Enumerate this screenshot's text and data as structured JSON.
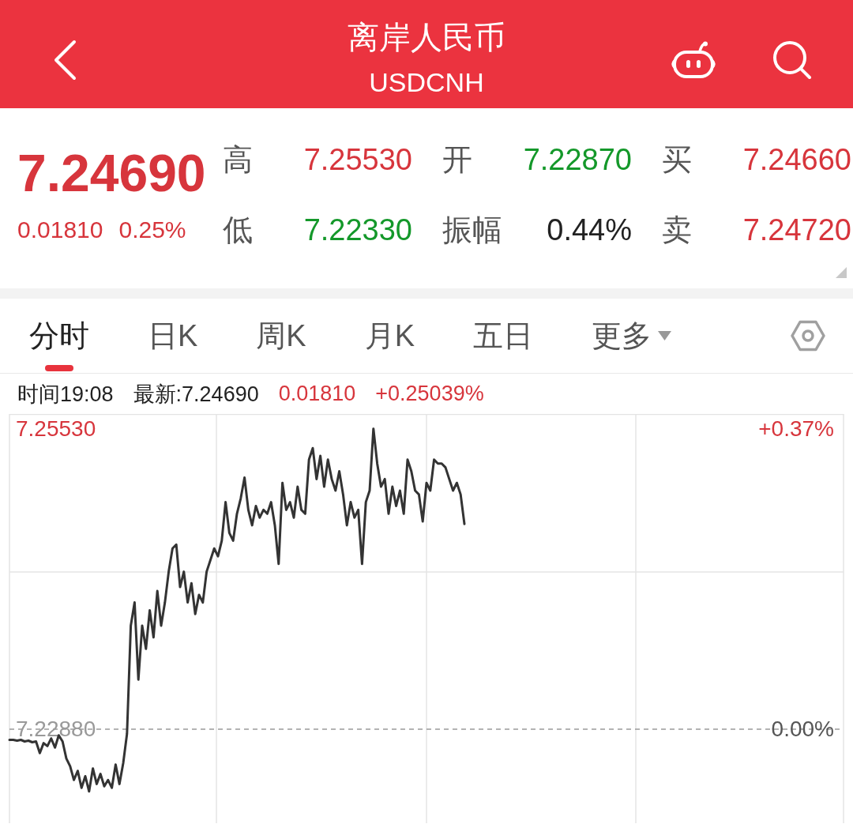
{
  "header": {
    "title": "离岸人民币",
    "subtitle": "USDCNH"
  },
  "quote": {
    "price": "7.24690",
    "change": "0.01810",
    "change_percent": "0.25%",
    "color": "#d7353c",
    "fields": [
      {
        "label": "高",
        "value": "7.25530",
        "color": "#d7353c"
      },
      {
        "label": "开",
        "value": "7.22870",
        "color": "#14982a"
      },
      {
        "label": "买",
        "value": "7.24660",
        "color": "#d7353c"
      },
      {
        "label": "低",
        "value": "7.22330",
        "color": "#14982a"
      },
      {
        "label": "振幅",
        "value": "0.44%",
        "color": "#222222"
      },
      {
        "label": "卖",
        "value": "7.24720",
        "color": "#d7353c"
      }
    ]
  },
  "tabs": [
    {
      "label": "分时",
      "selected": true,
      "kind": "tab"
    },
    {
      "label": "日K",
      "selected": false,
      "kind": "tab"
    },
    {
      "label": "周K",
      "selected": false,
      "kind": "tab"
    },
    {
      "label": "月K",
      "selected": false,
      "kind": "tab"
    },
    {
      "label": "五日",
      "selected": false,
      "kind": "tab"
    },
    {
      "label": "更多",
      "selected": false,
      "kind": "menu"
    }
  ],
  "info_bar": [
    {
      "text": "时间19:08",
      "color": "#222222"
    },
    {
      "text": "最新:7.24690",
      "color": "#222222"
    },
    {
      "text": "0.01810",
      "color": "#d7353c"
    },
    {
      "text": "+0.25039%",
      "color": "#d7353c"
    }
  ],
  "chart": {
    "chart_data": {
      "type": "line",
      "ylim": [
        7.2205,
        7.2566
      ],
      "yticks": [
        {
          "value": 7.2553,
          "label": "7.25530"
        },
        {
          "value": 7.2288,
          "label": "7.22880"
        }
      ],
      "ref_lines": [
        {
          "axis": "y",
          "value": 7.2288
        }
      ],
      "annotations": [
        "+0.37%",
        "0.00%"
      ],
      "series": [
        {
          "color": "#333333",
          "values": [
            7.22785,
            7.22785,
            7.22778,
            7.22785,
            7.22771,
            7.22778,
            7.22764,
            7.22771,
            7.22669,
            7.22757,
            7.2273,
            7.22798,
            7.22717,
            7.22826,
            7.22771,
            7.22621,
            7.22553,
            7.22431,
            7.22512,
            7.22362,
            7.22465,
            7.2233,
            7.22533,
            7.22396,
            7.22485,
            7.22376,
            7.22431,
            7.22362,
            7.22567,
            7.22396,
            7.2258,
            7.22839,
            7.23793,
            7.23997,
            7.23316,
            7.23793,
            7.23588,
            7.23929,
            7.2369,
            7.24099,
            7.23793,
            7.23997,
            7.24269,
            7.24474,
            7.24508,
            7.24133,
            7.24269,
            7.23997,
            7.24167,
            7.23895,
            7.24065,
            7.23997,
            7.24269,
            7.24371,
            7.24474,
            7.24405,
            7.24542,
            7.24882,
            7.2461,
            7.24542,
            7.2478,
            7.24916,
            7.251,
            7.24814,
            7.24678,
            7.24848,
            7.24746,
            7.24814,
            7.2478,
            7.24882,
            7.24678,
            7.24337,
            7.25052,
            7.24814,
            7.24882,
            7.24746,
            7.25018,
            7.24814,
            7.2478,
            7.25257,
            7.25359,
            7.25086,
            7.25291,
            7.25018,
            7.25257,
            7.25086,
            7.24984,
            7.25155,
            7.2495,
            7.24678,
            7.24882,
            7.24746,
            7.24814,
            7.24337,
            7.24882,
            7.24984,
            7.2553,
            7.25223,
            7.25018,
            7.25086,
            7.2478,
            7.25018,
            7.24848,
            7.24984,
            7.2478,
            7.25257,
            7.25155,
            7.24984,
            7.2495,
            7.24712,
            7.25052,
            7.24984,
            7.25257,
            7.25223,
            7.25223,
            7.25189,
            7.25086,
            7.24984,
            7.25052,
            7.2495,
            7.2469,
            null,
            null,
            null,
            null,
            null,
            null,
            null,
            null,
            null,
            null,
            null,
            null,
            null,
            null,
            null,
            null,
            null,
            null,
            null,
            null,
            null,
            null,
            null,
            null,
            null,
            null,
            null,
            null,
            null,
            null,
            null,
            null,
            null,
            null,
            null,
            null,
            null,
            null,
            null,
            null,
            null,
            null,
            null,
            null,
            null,
            null,
            null,
            null,
            null,
            null,
            null,
            null,
            null,
            null,
            null,
            null,
            null,
            null,
            null,
            null,
            null,
            null,
            null,
            null,
            null,
            null,
            null,
            null,
            null,
            null,
            null,
            null,
            null,
            null,
            null,
            null,
            null,
            null,
            null,
            null,
            null,
            null,
            null,
            null,
            null,
            null,
            null,
            null,
            null,
            null,
            null,
            null,
            null,
            null,
            null,
            null,
            null,
            null,
            null,
            null
          ]
        }
      ]
    }
  }
}
